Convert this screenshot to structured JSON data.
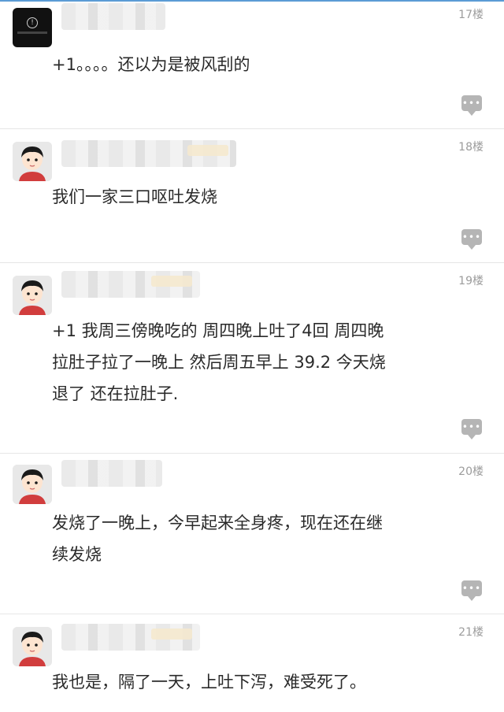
{
  "posts": [
    {
      "floor": "17楼",
      "content": "+1。。。。还以为是被风刮的",
      "avatar_icon": "warning-icon"
    },
    {
      "floor": "18楼",
      "content": "我们一家三口呕吐发烧",
      "avatar_icon": "user-avatar"
    },
    {
      "floor": "19楼",
      "content": "+1 我周三傍晚吃的 周四晚上吐了4回 周四晚\n拉肚子拉了一晚上 然后周五早上 39.2 今天烧\n退了 还在拉肚子.",
      "avatar_icon": "user-avatar"
    },
    {
      "floor": "20楼",
      "content": "发烧了一晚上，今早起来全身疼，现在还在继\n续发烧",
      "avatar_icon": "user-avatar"
    },
    {
      "floor": "21楼",
      "content": "我也是，隔了一天，上吐下泻，难受死了。",
      "avatar_icon": "user-avatar"
    }
  ],
  "reply_icon": "comment-icon",
  "colors": {
    "accent_line": "#5b9bd5",
    "floor_text": "#9c9c9c",
    "reply_button": "#b5b5b5"
  }
}
